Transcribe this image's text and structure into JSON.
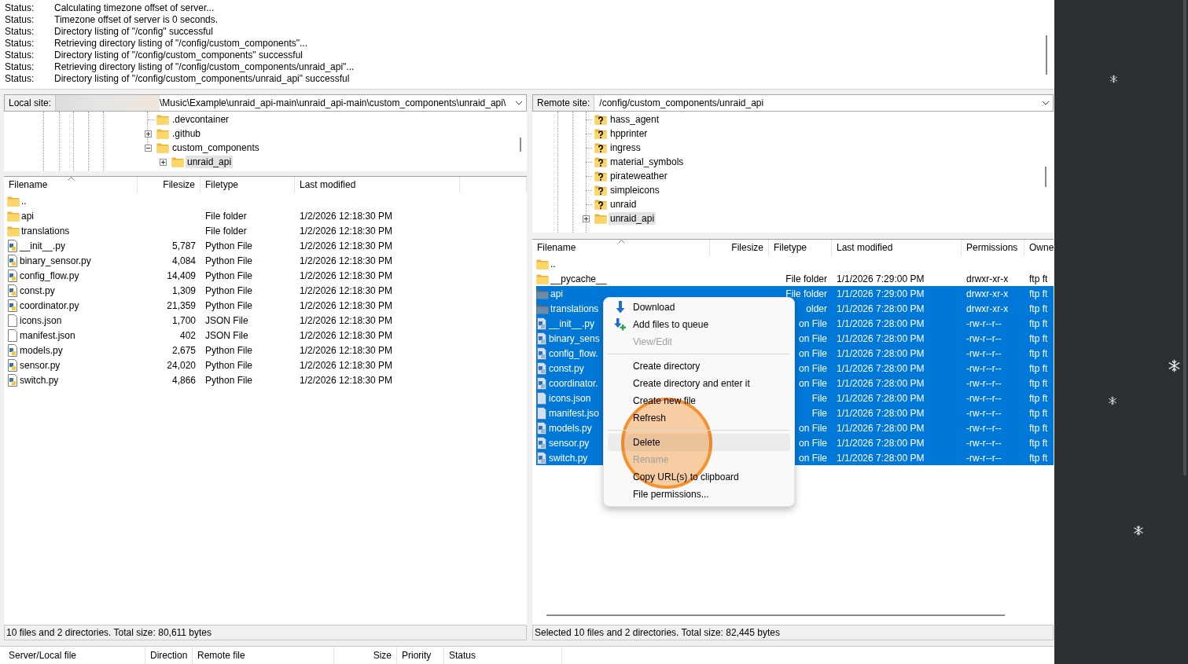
{
  "log": [
    {
      "label": "Status:",
      "message": "Calculating timezone offset of server..."
    },
    {
      "label": "Status:",
      "message": "Timezone offset of server is 0 seconds."
    },
    {
      "label": "Status:",
      "message": "Directory listing of \"/config\" successful"
    },
    {
      "label": "Status:",
      "message": "Retrieving directory listing of \"/config/custom_components\"..."
    },
    {
      "label": "Status:",
      "message": "Directory listing of \"/config/custom_components\" successful"
    },
    {
      "label": "Status:",
      "message": "Retrieving directory listing of \"/config/custom_components/unraid_api\"..."
    },
    {
      "label": "Status:",
      "message": "Directory listing of \"/config/custom_components/unraid_api\" successful"
    }
  ],
  "local_site": {
    "label": "Local site:",
    "path": "\\Music\\Example\\unraid_api-main\\unraid_api-main\\custom_components\\unraid_api\\"
  },
  "local_tree": [
    {
      "name": ".devcontainer",
      "kind": "folder",
      "expandable": false,
      "selected": false
    },
    {
      "name": ".github",
      "kind": "folder",
      "expandable": true,
      "expanded": false,
      "selected": false
    },
    {
      "name": "custom_components",
      "kind": "folder",
      "expandable": true,
      "expanded": true,
      "selected": false,
      "children": [
        {
          "name": "unraid_api",
          "kind": "folder",
          "expandable": true,
          "expanded": false,
          "selected": true
        }
      ]
    }
  ],
  "local_list": {
    "columns": [
      "Filename",
      "Filesize",
      "Filetype",
      "Last modified"
    ],
    "rows": [
      {
        "name": "..",
        "kind": "folder"
      },
      {
        "name": "api",
        "kind": "folder",
        "type": "File folder",
        "modified": "1/2/2026 12:18:30 PM"
      },
      {
        "name": "translations",
        "kind": "folder",
        "type": "File folder",
        "modified": "1/2/2026 12:18:30 PM"
      },
      {
        "name": "__init__.py",
        "kind": "python",
        "size": "5,787",
        "type": "Python File",
        "modified": "1/2/2026 12:18:30 PM"
      },
      {
        "name": "binary_sensor.py",
        "kind": "python",
        "size": "4,084",
        "type": "Python File",
        "modified": "1/2/2026 12:18:30 PM"
      },
      {
        "name": "config_flow.py",
        "kind": "python",
        "size": "14,409",
        "type": "Python File",
        "modified": "1/2/2026 12:18:30 PM"
      },
      {
        "name": "const.py",
        "kind": "python",
        "size": "1,309",
        "type": "Python File",
        "modified": "1/2/2026 12:18:30 PM"
      },
      {
        "name": "coordinator.py",
        "kind": "python",
        "size": "21,359",
        "type": "Python File",
        "modified": "1/2/2026 12:18:30 PM"
      },
      {
        "name": "icons.json",
        "kind": "file",
        "size": "1,700",
        "type": "JSON File",
        "modified": "1/2/2026 12:18:30 PM"
      },
      {
        "name": "manifest.json",
        "kind": "file",
        "size": "402",
        "type": "JSON File",
        "modified": "1/2/2026 12:18:30 PM"
      },
      {
        "name": "models.py",
        "kind": "python",
        "size": "2,675",
        "type": "Python File",
        "modified": "1/2/2026 12:18:30 PM"
      },
      {
        "name": "sensor.py",
        "kind": "python",
        "size": "24,020",
        "type": "Python File",
        "modified": "1/2/2026 12:18:30 PM"
      },
      {
        "name": "switch.py",
        "kind": "python",
        "size": "4,866",
        "type": "Python File",
        "modified": "1/2/2026 12:18:30 PM"
      }
    ]
  },
  "local_status": "10 files and 2 directories. Total size: 80,611 bytes",
  "remote_site": {
    "label": "Remote site:",
    "path": "/config/custom_components/unraid_api"
  },
  "remote_tree": [
    {
      "name": "hass_agent",
      "kind": "unknown",
      "expandable": false,
      "selected": false
    },
    {
      "name": "hpprinter",
      "kind": "unknown",
      "expandable": false,
      "selected": false
    },
    {
      "name": "ingress",
      "kind": "unknown",
      "expandable": false,
      "selected": false
    },
    {
      "name": "material_symbols",
      "kind": "unknown",
      "expandable": false,
      "selected": false
    },
    {
      "name": "pirateweather",
      "kind": "unknown",
      "expandable": false,
      "selected": false
    },
    {
      "name": "simpleicons",
      "kind": "unknown",
      "expandable": false,
      "selected": false
    },
    {
      "name": "unraid",
      "kind": "unknown",
      "expandable": false,
      "selected": false
    },
    {
      "name": "unraid_api",
      "kind": "folder",
      "expandable": true,
      "expanded": false,
      "selected": true
    }
  ],
  "remote_list": {
    "columns": [
      "Filename",
      "Filesize",
      "Filetype",
      "Last modified",
      "Permissions",
      "Owne"
    ],
    "rows": [
      {
        "name": "..",
        "kind": "folder",
        "selected": false
      },
      {
        "name": "__pycache__",
        "kind": "folder",
        "selected": false,
        "type": "File folder",
        "modified": "1/1/2026 7:29:00 PM",
        "permissions": "drwxr-xr-x",
        "owner": "ftp ft"
      },
      {
        "name": "api",
        "kind": "folder",
        "selected": true,
        "type": "File folder",
        "modified": "1/1/2026 7:29:00 PM",
        "permissions": "drwxr-xr-x",
        "owner": "ftp ft"
      },
      {
        "name": "translations",
        "kind": "folder",
        "selected": true,
        "type": "older",
        "modified": "1/1/2026 7:28:00 PM",
        "permissions": "drwxr-xr-x",
        "owner": "ftp ft"
      },
      {
        "name": "__init__.py",
        "kind": "python",
        "selected": true,
        "type": "on File",
        "modified": "1/1/2026 7:28:00 PM",
        "permissions": "-rw-r--r--",
        "owner": "ftp ft"
      },
      {
        "name": "binary_sens",
        "kind": "python",
        "selected": true,
        "type": "on File",
        "modified": "1/1/2026 7:28:00 PM",
        "permissions": "-rw-r--r--",
        "owner": "ftp ft"
      },
      {
        "name": "config_flow.",
        "kind": "python",
        "selected": true,
        "type": "on File",
        "modified": "1/1/2026 7:28:00 PM",
        "permissions": "-rw-r--r--",
        "owner": "ftp ft"
      },
      {
        "name": "const.py",
        "kind": "python",
        "selected": true,
        "type": "on File",
        "modified": "1/1/2026 7:28:00 PM",
        "permissions": "-rw-r--r--",
        "owner": "ftp ft"
      },
      {
        "name": "coordinator.",
        "kind": "python",
        "selected": true,
        "type": "on File",
        "modified": "1/1/2026 7:28:00 PM",
        "permissions": "-rw-r--r--",
        "owner": "ftp ft"
      },
      {
        "name": "icons.json",
        "kind": "file",
        "selected": true,
        "type": "File",
        "modified": "1/1/2026 7:28:00 PM",
        "permissions": "-rw-r--r--",
        "owner": "ftp ft"
      },
      {
        "name": "manifest.jso",
        "kind": "file",
        "selected": true,
        "type": "File",
        "modified": "1/1/2026 7:28:00 PM",
        "permissions": "-rw-r--r--",
        "owner": "ftp ft"
      },
      {
        "name": "models.py",
        "kind": "python",
        "selected": true,
        "type": "on File",
        "modified": "1/1/2026 7:28:00 PM",
        "permissions": "-rw-r--r--",
        "owner": "ftp ft"
      },
      {
        "name": "sensor.py",
        "kind": "python",
        "selected": true,
        "type": "on File",
        "modified": "1/1/2026 7:28:00 PM",
        "permissions": "-rw-r--r--",
        "owner": "ftp ft"
      },
      {
        "name": "switch.py",
        "kind": "python",
        "selected": true,
        "type": "on File",
        "modified": "1/1/2026 7:28:00 PM",
        "permissions": "-rw-r--r--",
        "owner": "ftp ft"
      }
    ]
  },
  "remote_status": "Selected 10 files and 2 directories. Total size: 82,445 bytes",
  "context_menu": [
    {
      "kind": "download",
      "label": "Download",
      "disabled": false,
      "highlighted": false
    },
    {
      "kind": "enqueue",
      "label": "Add files to queue",
      "disabled": false,
      "highlighted": false
    },
    {
      "kind": "text",
      "label": "View/Edit",
      "disabled": true,
      "highlighted": false
    },
    {
      "kind": "separator"
    },
    {
      "kind": "text",
      "label": "Create directory",
      "disabled": false,
      "highlighted": false
    },
    {
      "kind": "text",
      "label": "Create directory and enter it",
      "disabled": false,
      "highlighted": false
    },
    {
      "kind": "text",
      "label": "Create new file",
      "disabled": false,
      "highlighted": false
    },
    {
      "kind": "text",
      "label": "Refresh",
      "disabled": false,
      "highlighted": false
    },
    {
      "kind": "separator"
    },
    {
      "kind": "text",
      "label": "Delete",
      "disabled": false,
      "highlighted": true
    },
    {
      "kind": "text",
      "label": "Rename",
      "disabled": true,
      "highlighted": false
    },
    {
      "kind": "text",
      "label": "Copy URL(s) to clipboard",
      "disabled": false,
      "highlighted": false
    },
    {
      "kind": "text",
      "label": "File permissions...",
      "disabled": false,
      "highlighted": false
    }
  ],
  "queue": {
    "columns": [
      "Server/Local file",
      "Direction",
      "Remote file",
      "Size",
      "Priority",
      "Status"
    ]
  }
}
